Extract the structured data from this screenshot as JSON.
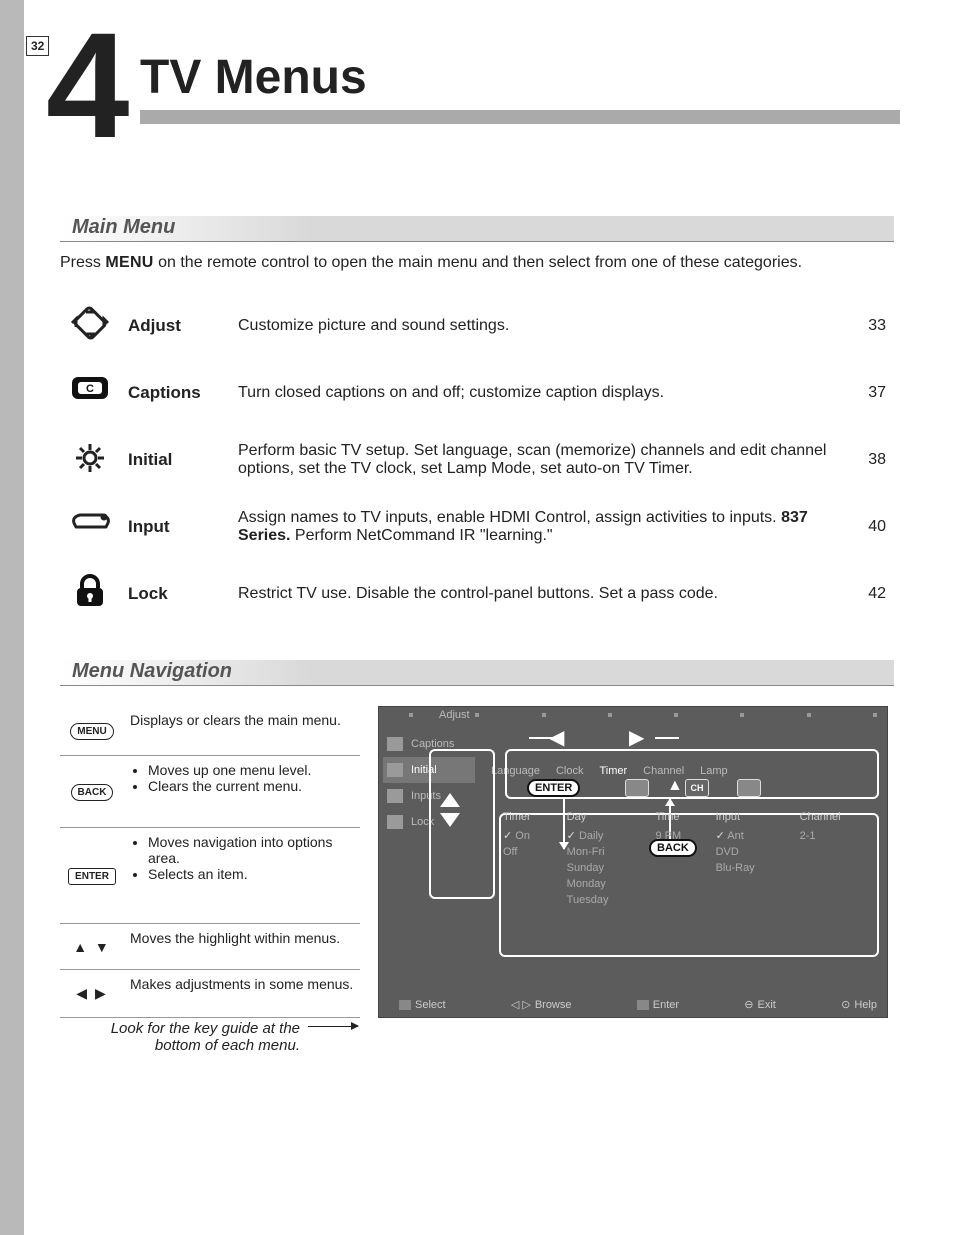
{
  "page_number": "32",
  "chapter_number": "4",
  "chapter_title": "TV Menus",
  "main_menu": {
    "header": "Main Menu",
    "intro_pre": "Press ",
    "intro_key": "MENU",
    "intro_post": " on the remote control to open the main menu and then select from one of these categories.",
    "rows": [
      {
        "name": "Adjust",
        "desc": "Customize picture and sound settings.",
        "page": "33"
      },
      {
        "name": "Captions",
        "desc": "Turn closed captions on and off; customize caption displays.",
        "page": "37"
      },
      {
        "name": "Initial",
        "desc": "Perform basic TV setup.  Set language, scan (memorize) channels and edit channel options, set the TV clock, set Lamp Mode, set auto-on TV Timer.",
        "page": "38"
      },
      {
        "name": "Input",
        "desc_pre": "Assign names to TV inputs, enable HDMI Control, assign activities to inputs.  ",
        "desc_bold": "837 Series.",
        "desc_post": "  Perform NetCommand IR \"learning.\"",
        "page": "40"
      },
      {
        "name": "Lock",
        "desc": "Restrict TV use.  Disable the control-panel buttons.  Set a pass code.",
        "page": "42"
      }
    ]
  },
  "nav": {
    "header": "Menu Navigation",
    "rows": [
      {
        "btn": "MENU",
        "type": "oval",
        "desc_items": [
          "Displays or clears the main menu."
        ]
      },
      {
        "btn": "BACK",
        "type": "oval",
        "desc_items": [
          "Moves up one menu level.",
          "Clears the current menu."
        ]
      },
      {
        "btn": "ENTER",
        "type": "square",
        "desc_items": [
          "Moves navigation into options area.",
          "Selects an item."
        ]
      },
      {
        "btn": "▲ ▼",
        "type": "arrows",
        "desc_items": [
          "Moves the highlight within menus."
        ]
      },
      {
        "btn": "◀ ▶",
        "type": "arrows",
        "desc_items": [
          "Makes adjustments in some menus."
        ]
      }
    ],
    "keyguide_note": "Look for the key guide at the bottom of each menu."
  },
  "tv": {
    "top_tab": "Adjust",
    "side": [
      "Captions",
      "Initial",
      "Inputs",
      "Lock"
    ],
    "side_active_index": 1,
    "subtabs": [
      "Language",
      "Clock",
      "Timer",
      "Channel",
      "Lamp"
    ],
    "enter_label": "ENTER",
    "back_label": "BACK",
    "ch_label": "CH",
    "columns": [
      "Timer",
      "Day",
      "Time",
      "Input",
      "Channel"
    ],
    "col_timer": [
      "On",
      "Off"
    ],
    "col_day": [
      "Daily",
      "Mon-Fri",
      "Sunday",
      "Monday",
      "Tuesday"
    ],
    "col_time": [
      "9 PM"
    ],
    "col_input": [
      "Ant",
      "DVD",
      "Blu-Ray"
    ],
    "col_channel": [
      "2-1"
    ],
    "bottom": [
      "Select",
      "Browse",
      "Enter",
      "Exit",
      "Help"
    ]
  }
}
